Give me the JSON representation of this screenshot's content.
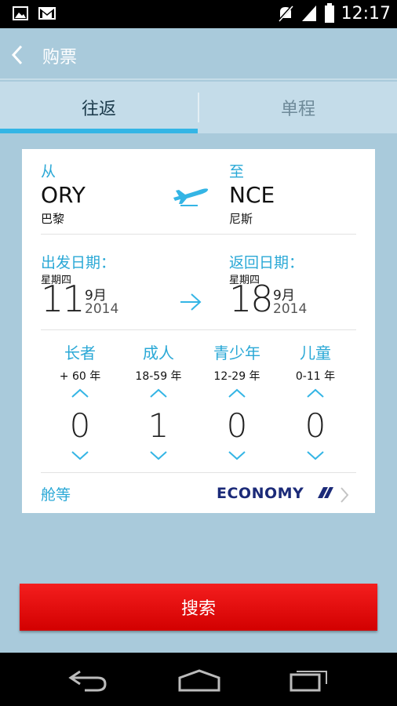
{
  "status_bar": {
    "time": "12:17",
    "left_icons": [
      "image-icon",
      "gmail-icon"
    ],
    "right_icons": [
      "mute-icon",
      "signal-icon",
      "battery-icon"
    ]
  },
  "action_bar": {
    "back_icon": "chevron-left-icon",
    "title": "购票"
  },
  "tabs": [
    {
      "label": "往返",
      "active": true
    },
    {
      "label": "单程",
      "active": false
    }
  ],
  "route": {
    "from_label": "从",
    "to_label": "至",
    "from_code": "ORY",
    "from_city": "巴黎",
    "to_code": "NCE",
    "to_city": "尼斯",
    "plane_icon": "plane-takeoff-icon"
  },
  "dates": {
    "departure_label": "出发日期：",
    "return_label": "返回日期：",
    "departure": {
      "weekday": "星期四",
      "day": "11",
      "month": "9月",
      "year": "2014"
    },
    "return": {
      "weekday": "星期四",
      "day": "18",
      "month": "9月",
      "year": "2014"
    },
    "arrow_icon": "arrow-right-icon"
  },
  "passengers": [
    {
      "label": "长者",
      "age": "+ 60 年",
      "count": "0"
    },
    {
      "label": "成人",
      "age": "18-59 年",
      "count": "1"
    },
    {
      "label": "青少年",
      "age": "12-29 年",
      "count": "0"
    },
    {
      "label": "儿童",
      "age": "0-11 年",
      "count": "0"
    }
  ],
  "cabin": {
    "label": "舱等",
    "value": "ECONOMY"
  },
  "search_button": "搜索",
  "nav_bar": {
    "icons": [
      "back-nav-icon",
      "home-nav-icon",
      "recent-apps-icon"
    ]
  },
  "colors": {
    "accent": "#2aa8d6",
    "tab_indicator": "#34b5e5",
    "background": "#a9cadb",
    "search_red": "#e00000",
    "economy_navy": "#1b2a78"
  }
}
